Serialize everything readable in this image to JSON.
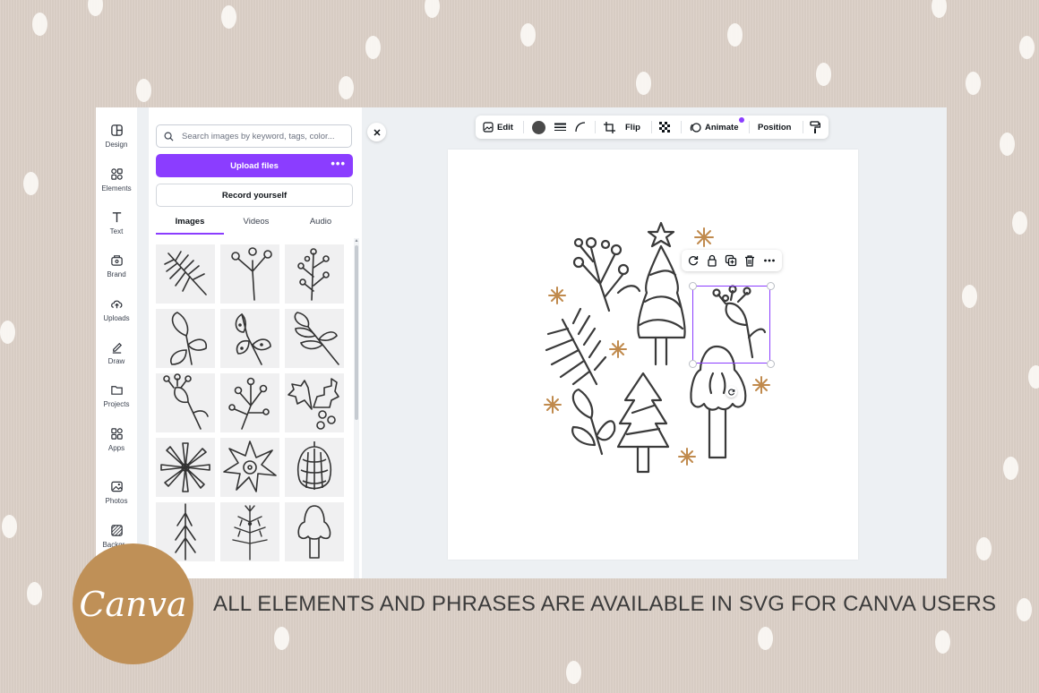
{
  "sidebar": {
    "items": [
      {
        "label": "Design",
        "icon": "design-icon"
      },
      {
        "label": "Elements",
        "icon": "elements-icon"
      },
      {
        "label": "Text",
        "icon": "text-icon"
      },
      {
        "label": "Brand",
        "icon": "brand-icon"
      },
      {
        "label": "Uploads",
        "icon": "uploads-icon"
      },
      {
        "label": "Draw",
        "icon": "draw-icon"
      },
      {
        "label": "Projects",
        "icon": "projects-icon"
      },
      {
        "label": "Apps",
        "icon": "apps-icon"
      },
      {
        "label": "Photos",
        "icon": "photos-icon"
      },
      {
        "label": "Backgr...",
        "icon": "background-icon"
      }
    ]
  },
  "panel": {
    "search_placeholder": "Search images by keyword, tags, color...",
    "upload_label": "Upload files",
    "upload_more": "•••",
    "record_label": "Record yourself",
    "tabs": [
      {
        "label": "Images",
        "active": true
      },
      {
        "label": "Videos",
        "active": false
      },
      {
        "label": "Audio",
        "active": false
      }
    ],
    "thumbnails": [
      "pine-branch",
      "berry-sprig",
      "berry-branch",
      "leaf-sprig",
      "dotted-leaves",
      "leafy-branch",
      "flower-bud-sprig",
      "berry-cluster",
      "holly-leaves",
      "star-flower",
      "poinsettia",
      "pinecone",
      "fir-tree-stick",
      "fir-branch-tree",
      "rounded-tree"
    ]
  },
  "toolbar": {
    "edit_label": "Edit",
    "flip_label": "Flip",
    "animate_label": "Animate",
    "position_label": "Position",
    "color_swatch": "#4a4a4a",
    "accent": "#8b3dff"
  },
  "colors": {
    "stroke": "#3a3a3a",
    "snowflake": "#c08a4d",
    "purple": "#8b3dff",
    "badge": "#bf9057"
  },
  "footer": {
    "brand": "Canva",
    "tagline": "ALL ELEMENTS AND PHRASES ARE AVAILABLE IN SVG FOR CANVA USERS"
  }
}
